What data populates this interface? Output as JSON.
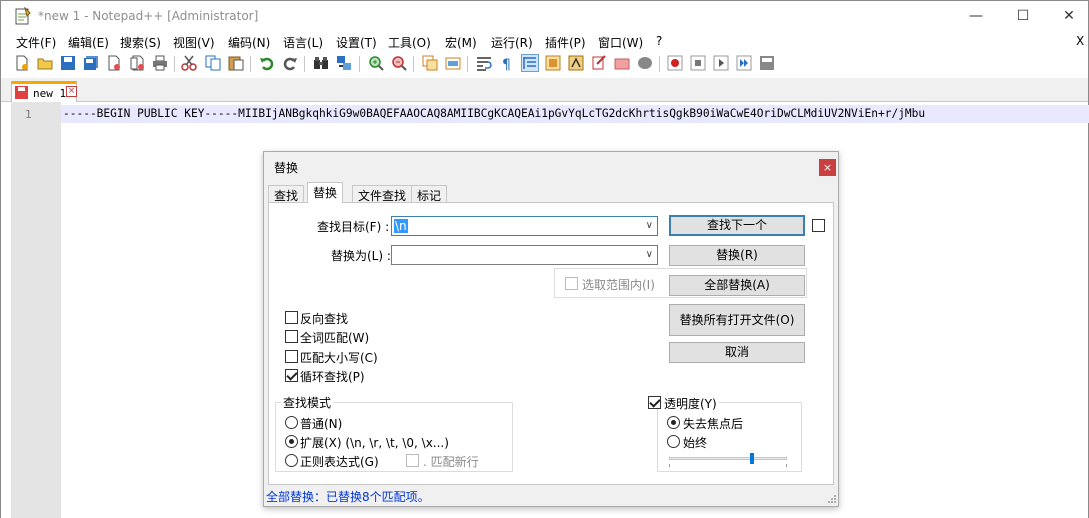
{
  "window": {
    "title": "*new 1 - Notepad++ [Administrator]",
    "controls": {
      "minimize": "—",
      "maximize": "☐",
      "close": "✕"
    }
  },
  "menu": {
    "items": [
      "文件(F)",
      "编辑(E)",
      "搜索(S)",
      "视图(V)",
      "编码(N)",
      "语言(L)",
      "设置(T)",
      "工具(O)",
      "宏(M)",
      "运行(R)",
      "插件(P)",
      "窗口(W)",
      "?"
    ],
    "close_x": "X"
  },
  "toolbar": {
    "icons": [
      "new-file-icon",
      "open-file-icon",
      "save-icon",
      "save-all-icon",
      "close-icon",
      "close-all-icon",
      "print-icon",
      "cut-icon",
      "copy-icon",
      "paste-icon",
      "undo-icon",
      "redo-icon",
      "find-icon",
      "replace-icon",
      "zoom-in-icon",
      "zoom-out-icon",
      "sync-vertical-icon",
      "sync-horizontal-icon",
      "word-wrap-icon",
      "show-all-chars-icon",
      "indent-guide-icon",
      "document-map-icon",
      "function-list-icon",
      "folder-workspace-icon",
      "monitoring-icon",
      "macro-record-icon",
      "macro-stop-icon",
      "macro-play-icon",
      "macro-run-multiple-icon",
      "macro-save-icon"
    ]
  },
  "tab": {
    "label": "new 1",
    "close": "×"
  },
  "editor": {
    "line_number": "1",
    "line_text": "-----BEGIN PUBLIC KEY-----MIIBIjANBgkqhkiG9w0BAQEFAAOCAQ8AMIIBCgKCAQEAi1pGvYqLcTG2dcKhrtisQgkB90iWaCwE4OriDwCLMdiUV2NViEn+r/jMbu"
  },
  "dialog": {
    "title": "替换",
    "close": "×",
    "tabs": [
      "查找",
      "替换",
      "文件查找",
      "标记"
    ],
    "active_tab": "替换",
    "find_label": "查找目标(F) :",
    "find_value": "\\n",
    "replace_label": "替换为(L) :",
    "replace_value": "",
    "in_selection": "选取范围内(I)",
    "buttons": {
      "find_next": "查找下一个",
      "replace": "替换(R)",
      "replace_all": "全部替换(A)",
      "replace_all_open": "替换所有打开文件(O)",
      "cancel": "取消"
    },
    "options": [
      {
        "label": "反向查找",
        "checked": false
      },
      {
        "label": "全词匹配(W)",
        "checked": false
      },
      {
        "label": "匹配大小写(C)",
        "checked": false
      },
      {
        "label": "循环查找(P)",
        "checked": true
      }
    ],
    "search_mode": {
      "title": "查找模式",
      "normal": "普通(N)",
      "extended": "扩展(X) (\\n, \\r, \\t, \\0, \\x...)",
      "regex": "正则表达式(G)",
      "dot_newline": ". 匹配新行",
      "selected": "extended"
    },
    "transparency": {
      "title": "透明度(Y)",
      "enabled": true,
      "on_lose_focus": "失去焦点后",
      "always": "始终",
      "selected": "on_lose_focus",
      "level": 0.7
    },
    "status": "全部替换：已替换8个匹配项。"
  }
}
